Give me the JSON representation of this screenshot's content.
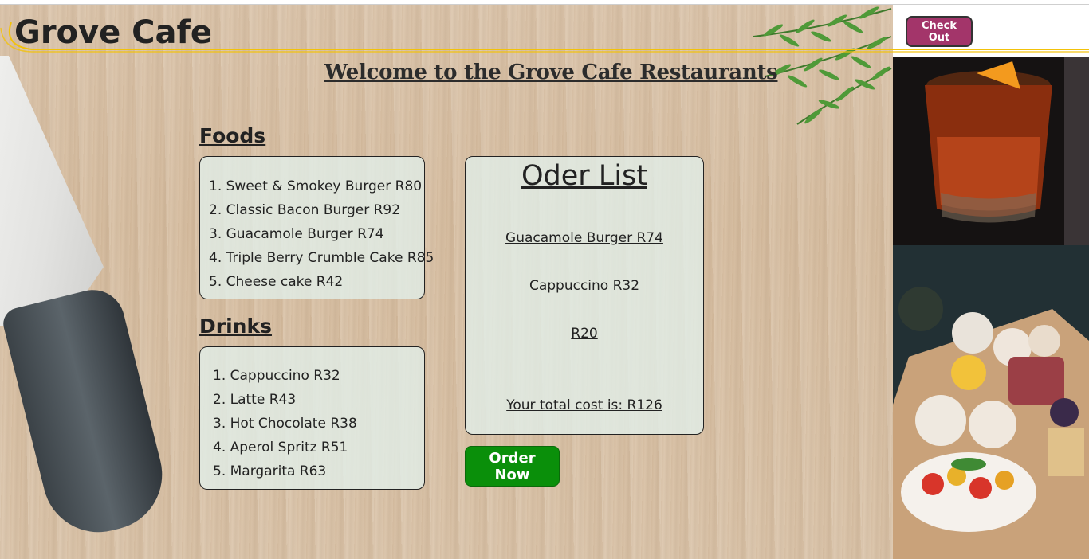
{
  "header": {
    "logo": "Grove Cafe",
    "welcome": "Welcome to the Grove Cafe Restaurants",
    "checkout_label": "Check Out"
  },
  "foods": {
    "title": "Foods",
    "items": [
      "1. Sweet & Smokey Burger R80",
      "2. Classic Bacon Burger R92",
      "3. Guacamole Burger R74",
      "4. Triple Berry Crumble Cake R85",
      "5. Cheese cake R42"
    ]
  },
  "drinks": {
    "title": "Drinks",
    "items": [
      "1. Cappuccino R32",
      "2. Latte R43",
      "3. Hot Chocolate R38",
      "4. Aperol Spritz R51",
      "5. Margarita R63"
    ]
  },
  "order_list": {
    "title": "Oder List",
    "items": [
      "Guacamole Burger R74",
      "Cappuccino R32",
      "R20"
    ],
    "total": "Your total cost is: R126"
  },
  "order_button": "Order Now",
  "colors": {
    "accent_yellow": "#f2c20a",
    "order_button": "#0a8f0a",
    "checkout_button": "#a3356a"
  }
}
